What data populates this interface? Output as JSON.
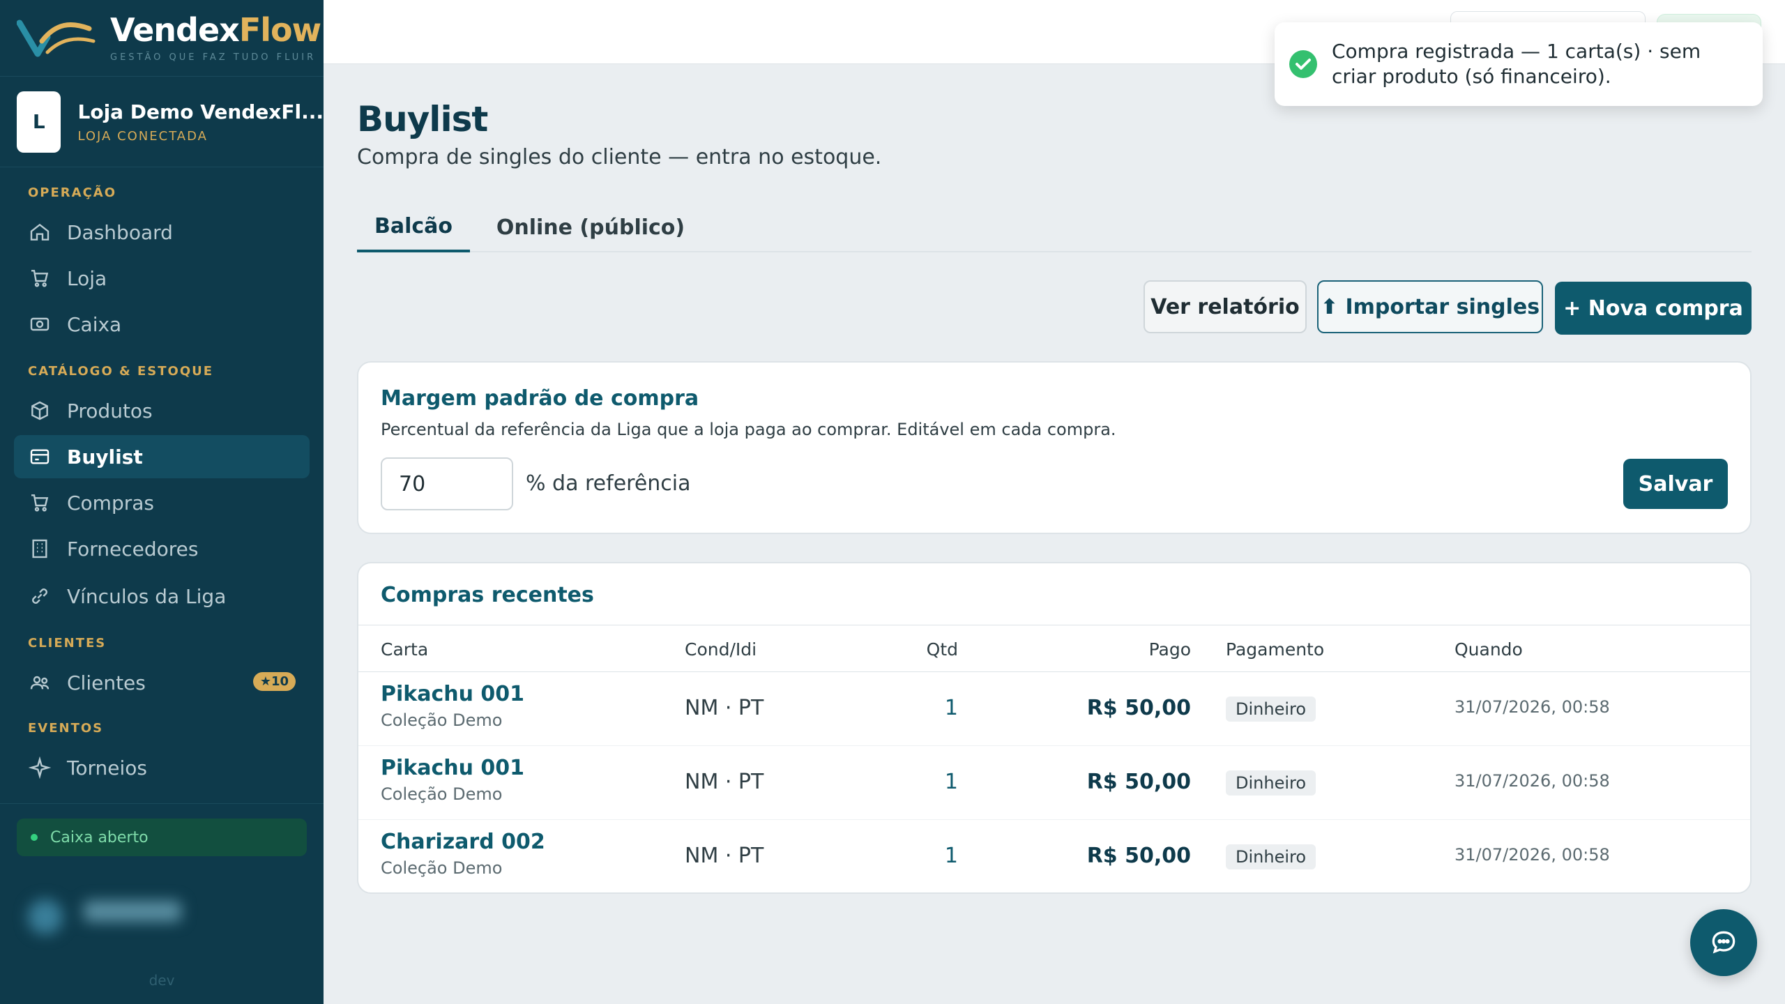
{
  "brand": {
    "name_a": "Vendex",
    "name_b": "Flow",
    "tagline": "GESTÃO QUE FAZ TUDO FLUIR"
  },
  "store": {
    "initial": "L",
    "name": "Loja Demo VendexFl...",
    "status": "LOJA CONECTADA"
  },
  "sidebar": {
    "sections": [
      "OPERAÇÃO",
      "CATÁLOGO & ESTOQUE",
      "CLIENTES",
      "EVENTOS"
    ],
    "items": [
      {
        "label": "Dashboard",
        "icon": "home-icon"
      },
      {
        "label": "Loja",
        "icon": "cart-icon"
      },
      {
        "label": "Caixa",
        "icon": "cash-icon"
      },
      {
        "label": "Produtos",
        "icon": "box-icon"
      },
      {
        "label": "Buylist",
        "icon": "card-icon"
      },
      {
        "label": "Compras",
        "icon": "cart-icon"
      },
      {
        "label": "Fornecedores",
        "icon": "building-icon"
      },
      {
        "label": "Vínculos da Liga",
        "icon": "link-icon"
      },
      {
        "label": "Clientes",
        "icon": "users-icon",
        "badge": "★10"
      },
      {
        "label": "Torneios",
        "icon": "sparkle-icon"
      }
    ],
    "active": "Buylist",
    "cash_status": "Caixa aberto",
    "env": "dev"
  },
  "toast": {
    "message": "Compra registrada — 1 carta(s) · sem criar produto (só financeiro)."
  },
  "page": {
    "title": "Buylist",
    "subtitle": "Compra de singles do cliente — entra no estoque.",
    "tabs": [
      "Balcão",
      "Online (público)"
    ],
    "active_tab": "Balcão"
  },
  "actions": {
    "report": "Ver relatório",
    "import": "⬆ Importar singles",
    "new": "+ Nova compra"
  },
  "margin": {
    "title": "Margem padrão de compra",
    "description": "Percentual da referência da Liga que a loja paga ao comprar. Editável em cada compra.",
    "value": "70",
    "suffix": "% da referência",
    "save": "Salvar"
  },
  "recent": {
    "title": "Compras recentes",
    "columns": [
      "Carta",
      "Cond/Idi",
      "Qtd",
      "Pago",
      "Pagamento",
      "Quando"
    ],
    "rows": [
      {
        "card": "Pikachu 001",
        "collection": "Coleção Demo",
        "cond": "NM · PT",
        "qty": "1",
        "paid": "R$ 50,00",
        "payment": "Dinheiro",
        "when": "31/07/2026, 00:58"
      },
      {
        "card": "Pikachu 001",
        "collection": "Coleção Demo",
        "cond": "NM · PT",
        "qty": "1",
        "paid": "R$ 50,00",
        "payment": "Dinheiro",
        "when": "31/07/2026, 00:58"
      },
      {
        "card": "Charizard 002",
        "collection": "Coleção Demo",
        "cond": "NM · PT",
        "qty": "1",
        "paid": "R$ 50,00",
        "payment": "Dinheiro",
        "when": "31/07/2026, 00:58"
      }
    ]
  },
  "colors": {
    "sidebar": "#0e3a4b",
    "accent": "#0e5a6d",
    "gold": "#d7ab57",
    "success": "#34c06f"
  }
}
